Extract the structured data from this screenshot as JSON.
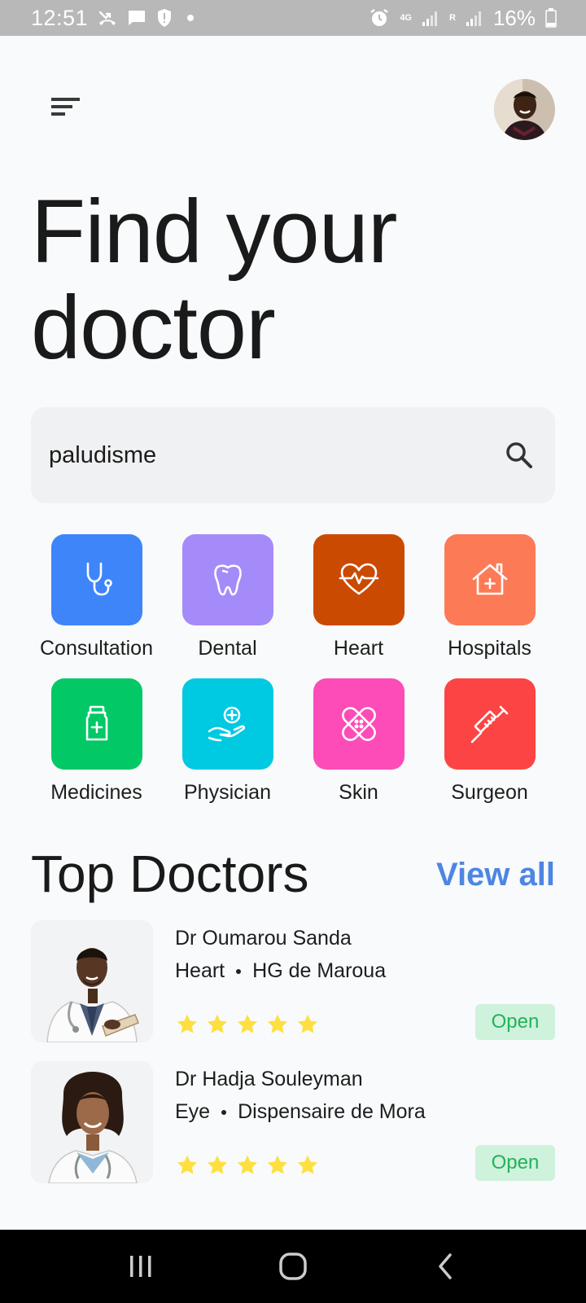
{
  "status_bar": {
    "time": "12:51",
    "battery": "16%",
    "network": "4G",
    "roaming": "R"
  },
  "header": {
    "title_line1": "Find your",
    "title_line2": "doctor"
  },
  "search": {
    "value": "paludisme"
  },
  "categories": [
    {
      "label": "Consultation",
      "color": "#3f85fa",
      "icon": "stethoscope-icon"
    },
    {
      "label": "Dental",
      "color": "#a58bf9",
      "icon": "tooth-icon"
    },
    {
      "label": "Heart",
      "color": "#cb4a02",
      "icon": "heart-pulse-icon"
    },
    {
      "label": "Hospitals",
      "color": "#fd7a56",
      "icon": "hospital-house-icon"
    },
    {
      "label": "Medicines",
      "color": "#02c866",
      "icon": "medicine-bottle-icon"
    },
    {
      "label": "Physician",
      "color": "#00c9e2",
      "icon": "care-hand-icon"
    },
    {
      "label": "Skin",
      "color": "#fd4bb8",
      "icon": "bandage-icon"
    },
    {
      "label": "Surgeon",
      "color": "#fd4444",
      "icon": "syringe-icon"
    }
  ],
  "top_doctors": {
    "title": "Top Doctors",
    "view_all": "View all",
    "doctors": [
      {
        "name": "Dr Oumarou Sanda",
        "specialty": "Heart",
        "location": "HG de Maroua",
        "rating": 5,
        "status": "Open"
      },
      {
        "name": "Dr Hadja Souleyman",
        "specialty": "Eye",
        "location": "Dispensaire de Mora",
        "rating": 5,
        "status": "Open"
      }
    ]
  },
  "colors": {
    "accent": "#4d86e3",
    "star": "#fde03f",
    "open_bg": "#cef2dc",
    "open_text": "#22b25a"
  }
}
